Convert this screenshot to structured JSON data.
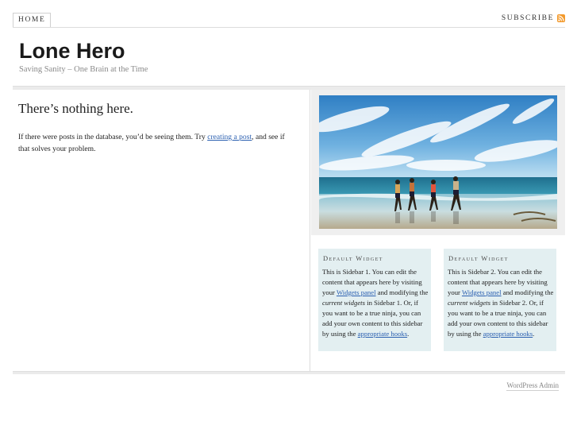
{
  "nav": {
    "home_label": "HOME",
    "subscribe_label": "SUBSCRIBE",
    "rss_icon": "rss-feed-icon"
  },
  "header": {
    "site_title": "Lone Hero",
    "tagline": "Saving Sanity – One Brain at the Time"
  },
  "main": {
    "heading": "There’s nothing here.",
    "body_before": "If there were posts in the database, you’d be seeing them. Try ",
    "link_text": "creating a post",
    "body_after": ", and see if that solves your problem."
  },
  "sidebar1": {
    "title": "Default Widget",
    "text1": "This is Sidebar 1. You can edit the content that appears here by visiting your ",
    "link1": "Widgets panel",
    "text2": " and modifying the ",
    "em": "current widgets",
    "text3": " in Sidebar 1. Or, if you want to be a true ninja, you can add your own content to this sidebar by using the ",
    "link2": "appropriate hooks",
    "text4": "."
  },
  "sidebar2": {
    "title": "Default Widget",
    "text1": "This is Sidebar 2. You can edit the content that appears here by visiting your ",
    "link1": "Widgets panel",
    "text2": " and modifying the ",
    "em": "current widgets",
    "text3": " in Sidebar 2. Or, if you want to be a true ninja, you can add your own content to this sidebar by using the ",
    "link2": "appropriate hooks",
    "text4": "."
  },
  "footer": {
    "admin_label": "WordPress Admin"
  },
  "colors": {
    "link": "#2a5fb0",
    "widget_bg": "#e3eff1",
    "rss": "#f39a2c"
  }
}
